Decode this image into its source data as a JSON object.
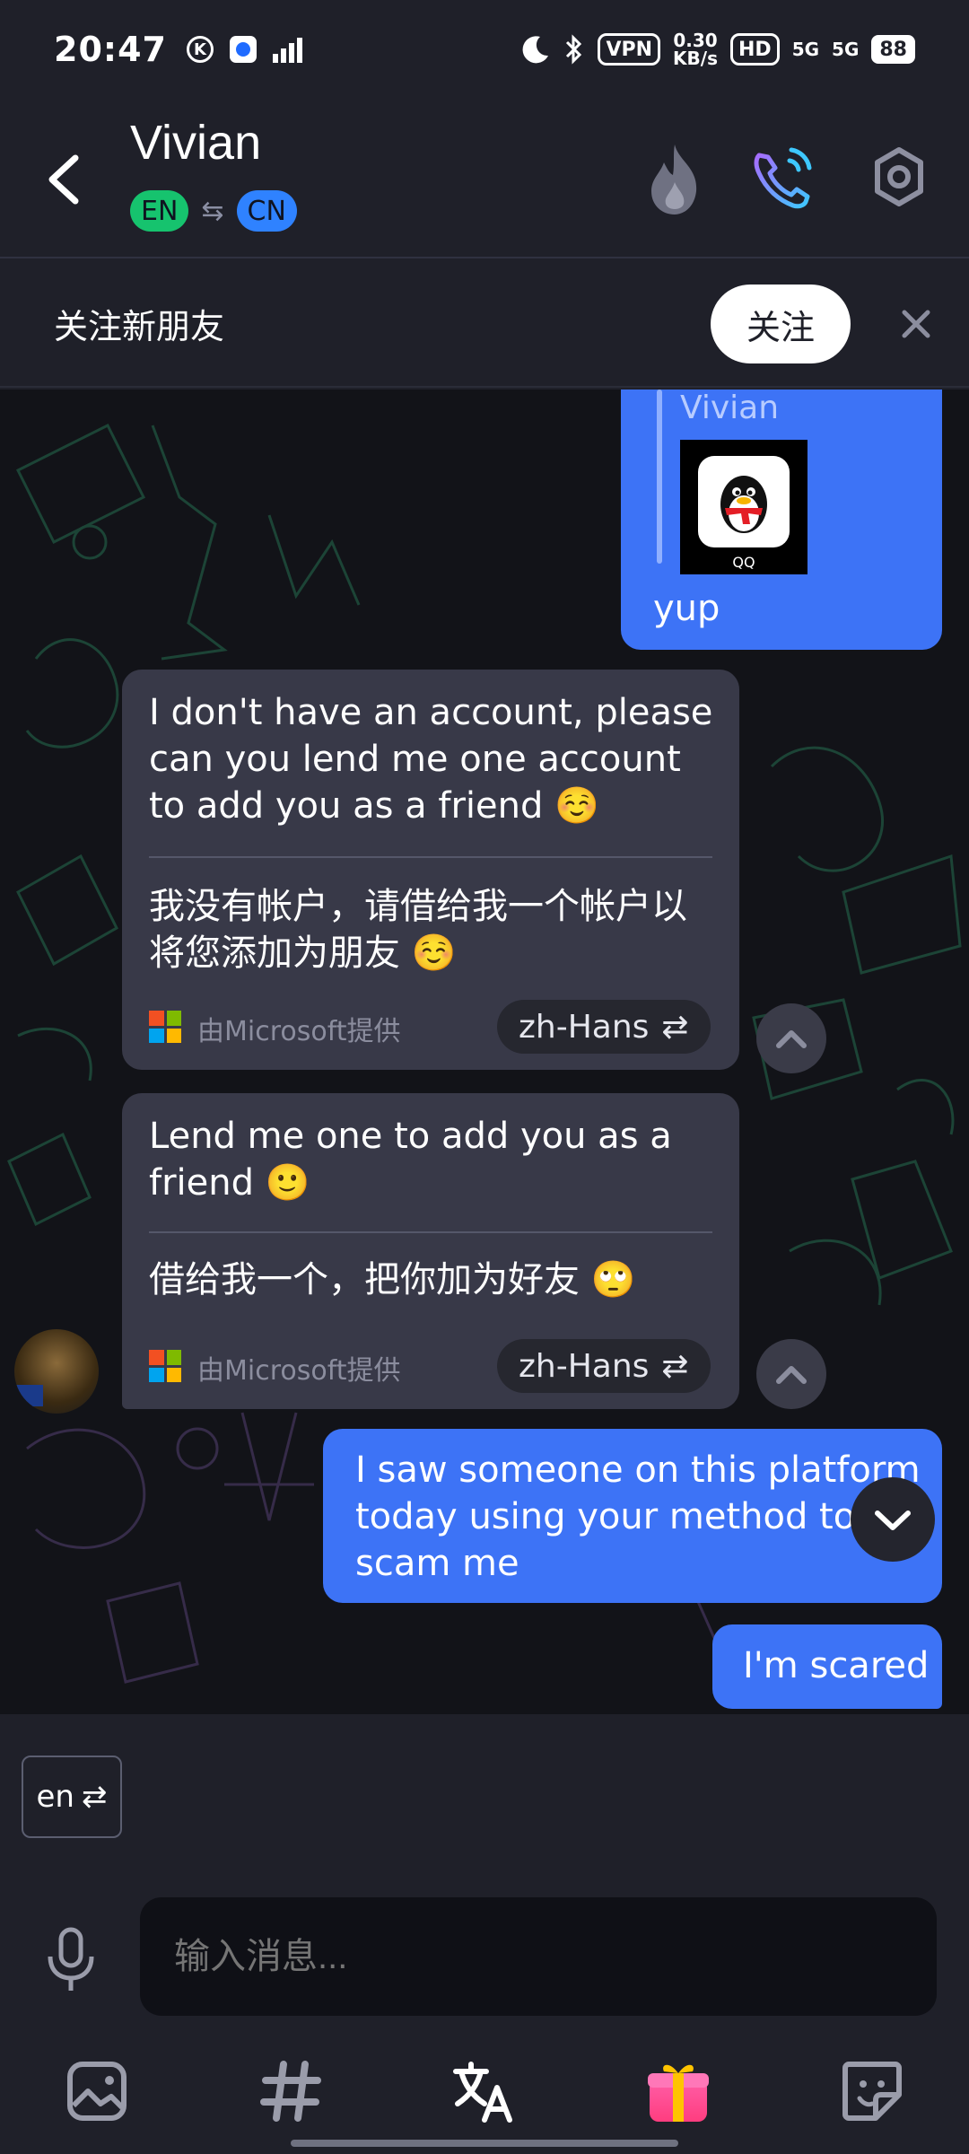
{
  "status_bar": {
    "time": "20:47",
    "network_speed_value": "0.30",
    "network_speed_unit": "KB/s",
    "vpn": "VPN",
    "hd": "HD",
    "net1": "5G",
    "net2": "5G",
    "battery": "88"
  },
  "header": {
    "contact_name": "Vivian",
    "from_lang": "EN",
    "to_lang": "CN"
  },
  "follow_bar": {
    "text": "关注新朋友",
    "button": "关注"
  },
  "messages": {
    "m1": {
      "quote_name": "Vivian",
      "image_caption": "QQ",
      "text": "yup"
    },
    "m2": {
      "original": "I don't have an account, please can you lend me one account to add you as a friend ☺️",
      "translated": "我没有帐户，请借给我一个帐户以将您添加为朋友 ☺️",
      "provider": "由Microsoft提供",
      "lang": "zh-Hans"
    },
    "m3": {
      "original": "Lend me one to add you as a friend 🙂",
      "translated": "借给我一个，把你加为好友 🙄",
      "provider": "由Microsoft提供",
      "lang": "zh-Hans"
    },
    "m4": {
      "text": "I saw someone on this platform today using your method to scam me"
    },
    "m5": {
      "text": "I'm scared"
    }
  },
  "composer": {
    "lang_toggle": "en",
    "placeholder": "输入消息..."
  },
  "colors": {
    "accent_blue": "#3d73f6",
    "incoming_bubble": "#383948",
    "en_pill": "#16c36e",
    "cn_pill": "#2f82ff"
  }
}
